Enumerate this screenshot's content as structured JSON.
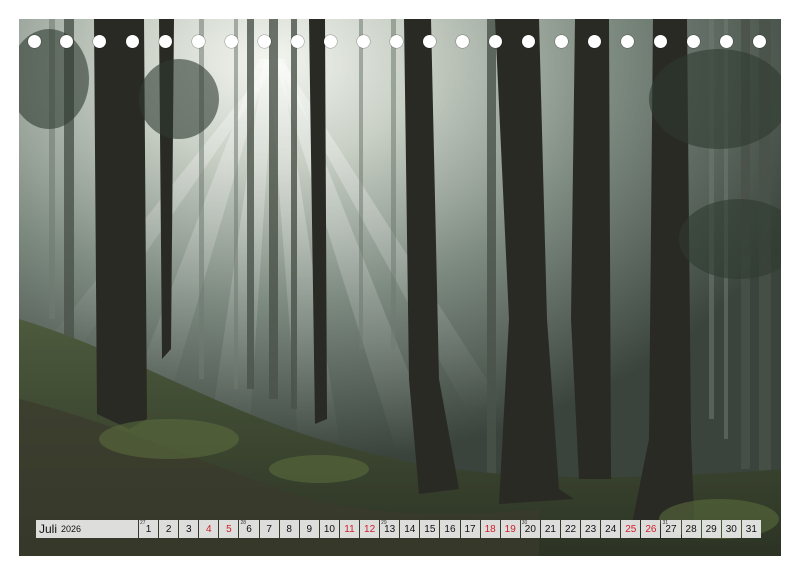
{
  "calendar": {
    "month": "Juli",
    "year": "2026",
    "week_markers": [
      "27",
      "28",
      "29",
      "30",
      "31"
    ],
    "days": [
      {
        "n": "1",
        "red": false,
        "wk": ""
      },
      {
        "n": "2",
        "red": false,
        "wk": ""
      },
      {
        "n": "3",
        "red": false,
        "wk": ""
      },
      {
        "n": "4",
        "red": true,
        "wk": ""
      },
      {
        "n": "5",
        "red": true,
        "wk": ""
      },
      {
        "n": "6",
        "red": false,
        "wk": "28"
      },
      {
        "n": "7",
        "red": false,
        "wk": ""
      },
      {
        "n": "8",
        "red": false,
        "wk": ""
      },
      {
        "n": "9",
        "red": false,
        "wk": ""
      },
      {
        "n": "10",
        "red": false,
        "wk": ""
      },
      {
        "n": "11",
        "red": true,
        "wk": ""
      },
      {
        "n": "12",
        "red": true,
        "wk": ""
      },
      {
        "n": "13",
        "red": false,
        "wk": "29"
      },
      {
        "n": "14",
        "red": false,
        "wk": ""
      },
      {
        "n": "15",
        "red": false,
        "wk": ""
      },
      {
        "n": "16",
        "red": false,
        "wk": ""
      },
      {
        "n": "17",
        "red": false,
        "wk": ""
      },
      {
        "n": "18",
        "red": true,
        "wk": ""
      },
      {
        "n": "19",
        "red": true,
        "wk": ""
      },
      {
        "n": "20",
        "red": false,
        "wk": "30"
      },
      {
        "n": "21",
        "red": false,
        "wk": ""
      },
      {
        "n": "22",
        "red": false,
        "wk": ""
      },
      {
        "n": "23",
        "red": false,
        "wk": ""
      },
      {
        "n": "24",
        "red": false,
        "wk": ""
      },
      {
        "n": "25",
        "red": true,
        "wk": ""
      },
      {
        "n": "26",
        "red": true,
        "wk": ""
      },
      {
        "n": "27",
        "red": false,
        "wk": "31"
      },
      {
        "n": "28",
        "red": false,
        "wk": ""
      },
      {
        "n": "29",
        "red": false,
        "wk": ""
      },
      {
        "n": "30",
        "red": false,
        "wk": ""
      },
      {
        "n": "31",
        "red": false,
        "wk": ""
      }
    ],
    "first_week": "27"
  },
  "colors": {
    "weekend": "#d0202a",
    "cell_bg": "#ebebeb"
  }
}
